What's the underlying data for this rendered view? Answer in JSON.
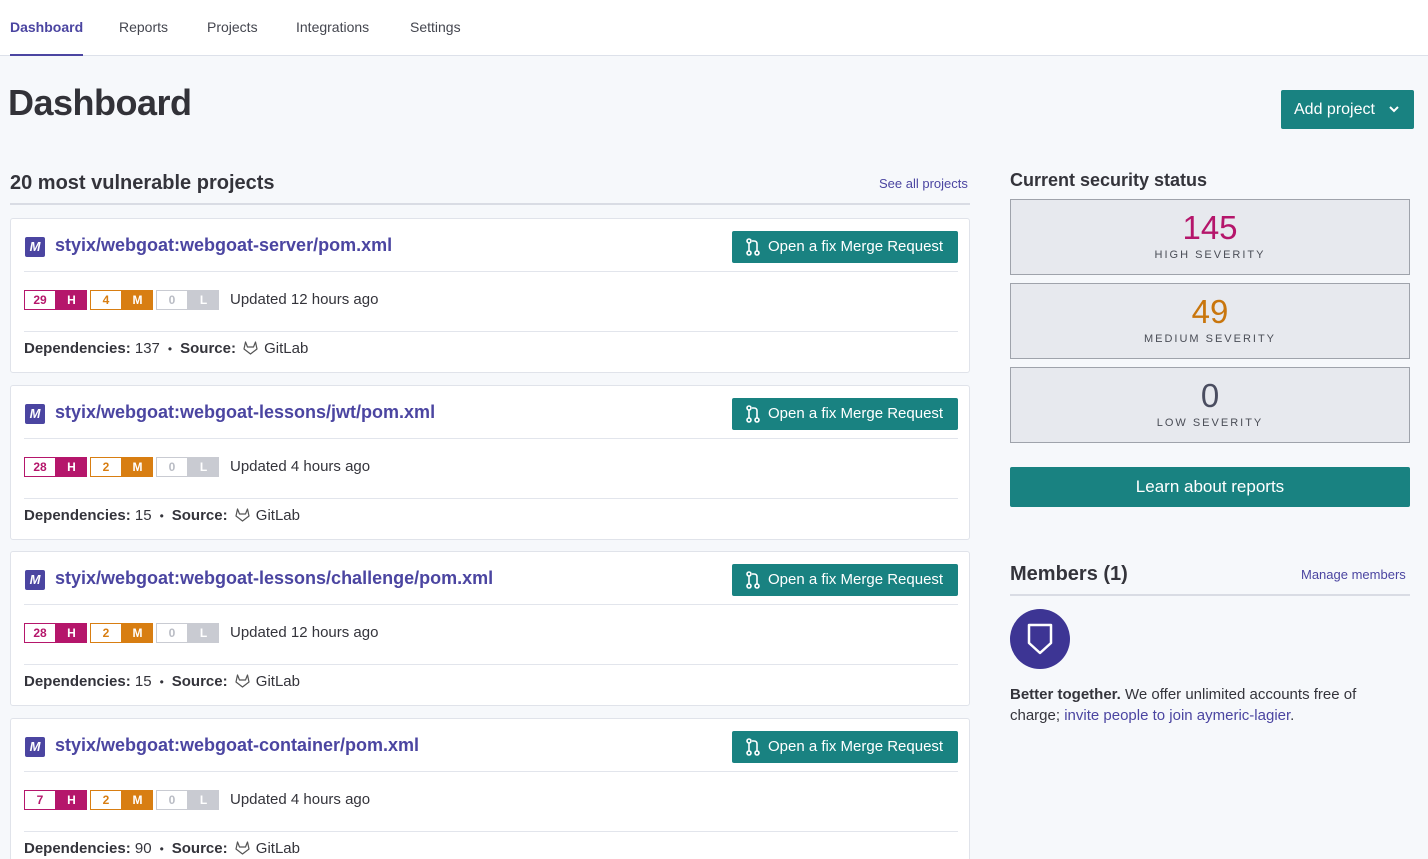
{
  "nav": {
    "tabs": [
      {
        "label": "Dashboard",
        "active": true
      },
      {
        "label": "Reports"
      },
      {
        "label": "Projects"
      },
      {
        "label": "Integrations"
      },
      {
        "label": "Settings"
      }
    ]
  },
  "header": {
    "title": "Dashboard",
    "add_project_label": "Add project"
  },
  "projects_section": {
    "title": "20 most vulnerable projects",
    "see_all_label": "See all projects"
  },
  "projects": [
    {
      "badge": "M",
      "name": "styix/webgoat:webgoat-server/pom.xml",
      "fix_label": "Open a fix Merge Request",
      "high": "29",
      "high_label": "H",
      "medium": "4",
      "medium_label": "M",
      "low": "0",
      "low_label": "L",
      "updated": "Updated 12 hours ago",
      "deps_label": "Dependencies:",
      "deps": "137",
      "source_label": "Source:",
      "source": "GitLab"
    },
    {
      "badge": "M",
      "name": "styix/webgoat:webgoat-lessons/jwt/pom.xml",
      "fix_label": "Open a fix Merge Request",
      "high": "28",
      "high_label": "H",
      "medium": "2",
      "medium_label": "M",
      "low": "0",
      "low_label": "L",
      "updated": "Updated 4 hours ago",
      "deps_label": "Dependencies:",
      "deps": "15",
      "source_label": "Source:",
      "source": "GitLab"
    },
    {
      "badge": "M",
      "name": "styix/webgoat:webgoat-lessons/challenge/pom.xml",
      "fix_label": "Open a fix Merge Request",
      "high": "28",
      "high_label": "H",
      "medium": "2",
      "medium_label": "M",
      "low": "0",
      "low_label": "L",
      "updated": "Updated 12 hours ago",
      "deps_label": "Dependencies:",
      "deps": "15",
      "source_label": "Source:",
      "source": "GitLab"
    },
    {
      "badge": "M",
      "name": "styix/webgoat:webgoat-container/pom.xml",
      "fix_label": "Open a fix Merge Request",
      "high": "7",
      "high_label": "H",
      "medium": "2",
      "medium_label": "M",
      "low": "0",
      "low_label": "L",
      "updated": "Updated 4 hours ago",
      "deps_label": "Dependencies:",
      "deps": "90",
      "source_label": "Source:",
      "source": "GitLab"
    }
  ],
  "security_status": {
    "title": "Current security status",
    "high": {
      "value": "145",
      "label": "HIGH SEVERITY",
      "color": "#b5166b"
    },
    "medium": {
      "value": "49",
      "label": "MEDIUM SEVERITY",
      "color": "#c9760d"
    },
    "low": {
      "value": "0",
      "label": "LOW SEVERITY",
      "color": "#4a4d60"
    },
    "learn_label": "Learn about reports"
  },
  "members": {
    "title": "Members (1)",
    "manage_label": "Manage members",
    "avatar_icon": "shield-icon",
    "better_bold": "Better together.",
    "better_text": " We offer unlimited accounts free of charge; ",
    "invite_link": "invite people to join aymeric-lagier",
    "period": "."
  },
  "colors": {
    "accent": "#4b45a1",
    "button": "#198281",
    "high": "#b5166b",
    "medium": "#d87e12",
    "low": "#c9cbd2"
  }
}
